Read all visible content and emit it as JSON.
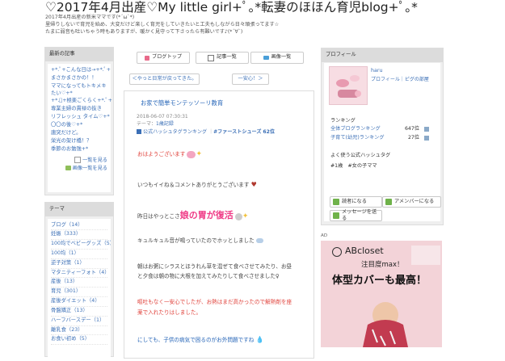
{
  "header": {
    "title": "♡2017年4月出産♡My little girl+ﾟ｡*転妻のほほん育児blog+ﾟ｡*",
    "desc_lines": [
      "2017年4月出産の新米ママです(*´ω`*)",
      "里帰りしないで育児を始め、大変だけど楽しく育児をしていきたいと工夫もしながら日々頑張ってます☆",
      "たまに弱音も吐いちゃう時もありますが、暖かく見守って下さったら有難いです♪(*´∀`)"
    ]
  },
  "left_sidebar": {
    "recent": {
      "heading": "最新の記事",
      "items": [
        "+*.ﾟ+こんな日は→+*.ﾟ+",
        "まさかまさかの！！",
        "ママになってもトキメキたい♡+*",
        "+*.ﾟ+極楽ごくらく+*.ﾟ+",
        "専業主婦の貫禄の抜き",
        "リフレッシュ タイム♡+*",
        "〇〇の後♡+*",
        "唐突だけど。",
        "栄光の架け橋！？",
        "季節のお勉強+*"
      ],
      "more_list": "一覧を見る",
      "more_images": "画像一覧を見る"
    },
    "themes": {
      "heading": "テーマ",
      "items": [
        "ブログ（14）",
        "妊娠（333）",
        "100均でベビーグッズ（5）",
        "100均（1）",
        "逆子対策（1）",
        "マタニティーフォト（4）",
        "産後（13）",
        "育児（301）",
        "産後ダイエット（4）",
        "骨盤矯正（13）",
        "ハーフバースデー（1）",
        "離乳食（23）",
        "お食い初め（5）"
      ]
    }
  },
  "top_nav": {
    "blog_top": "ブログトップ",
    "article_list": "記事一覧",
    "image_list": "画像一覧"
  },
  "post_nav": {
    "prev": "＜やっと日常が戻ってきた。",
    "next": "一安心！＞"
  },
  "article": {
    "title": "お家で簡単モンテッソーリ教育",
    "date": "2018-06-07 07:30:31",
    "theme_label": "テーマ：",
    "theme": "1歳記録",
    "hashtag_ranking": "公式ハッシュタグランキング",
    "hashtag": "#ファーストシューズ",
    "hashtag_rank": "62位",
    "greeting": "おはようございます",
    "line_thanks": "いつもイイね＆コメントありがとうございます",
    "line_yesterday_pre": "昨日はやっとこさ",
    "line_yesterday_big": "娘の胃が復活",
    "line_kyuru": "キュルキュル音が鳴っていたのでホッとしました",
    "line_meal1": "朝はお粥にシラスとほうれん草を混ぜて食べさせてみたり、お昼",
    "line_meal2": "と夕食は朝の物に大根を加えてみたりして食べさせました♀",
    "line_red1": "嘔吐もなく一安心でしたが、お熱はまだ高かったので解熱剤を座",
    "line_red2": "薬で入れたりはしました。",
    "line_blue": "にしても、子供の病気で困るのがお外問題ですね"
  },
  "profile": {
    "heading": "プロフィール",
    "name": "haru",
    "links": "プロフィール｜ピグの部屋",
    "ranking_label": "ランキング",
    "overall_label": "全体ブログランキング",
    "overall_value": "647位",
    "child_label": "子育て(幼児)ランキング",
    "child_value": "27位",
    "hashtag_heading": "よく使う公式ハッシュタグ",
    "hashtags": "#1歳　#女の子ママ",
    "reader_btn": "読者になる",
    "ameba_btn": "アメンバーになる",
    "message_btn": "メッセージを送る"
  },
  "ad": {
    "label": "AD",
    "brand": "ABcloset",
    "sub": "注目度max！",
    "headline": "体型カバーも最高！"
  }
}
